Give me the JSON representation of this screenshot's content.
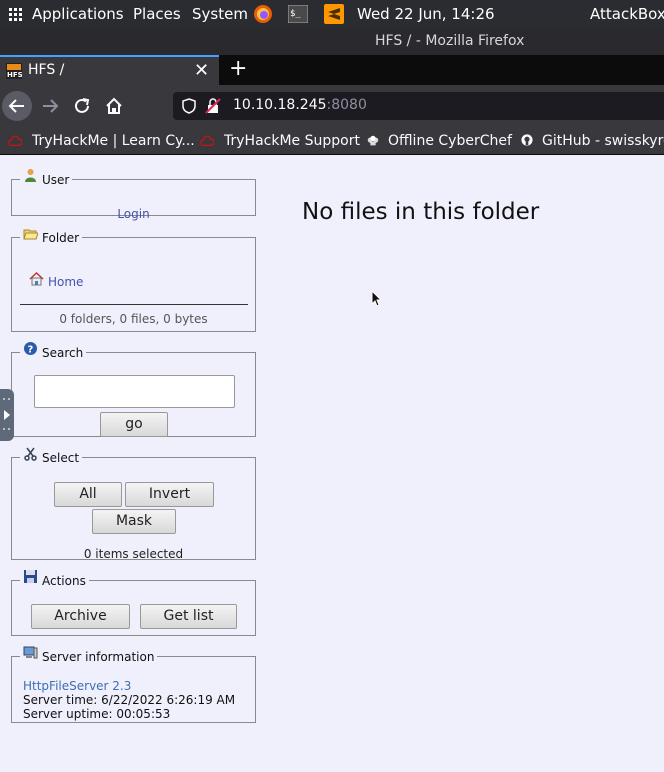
{
  "panel": {
    "applications": "Applications",
    "places": "Places",
    "system": "System",
    "datetime": "Wed 22 Jun, 14:26",
    "host": "AttackBox"
  },
  "window": {
    "title": "HFS / - Mozilla Firefox"
  },
  "tab": {
    "title": "HFS /",
    "close": "✕",
    "new_tab": "+"
  },
  "address": {
    "host": "10.10.18.245",
    "port": ":8080"
  },
  "bookmarks": [
    "TryHackMe | Learn Cy...",
    "TryHackMe Support",
    "Offline CyberChef",
    "GitHub - swisskyre"
  ],
  "page": {
    "user": {
      "legend": "User",
      "login": "Login"
    },
    "folder": {
      "legend": "Folder",
      "home": "Home",
      "stats": "0 folders, 0 files, 0 bytes"
    },
    "search": {
      "legend": "Search",
      "query": "",
      "go": "go"
    },
    "select": {
      "legend": "Select",
      "all": "All",
      "invert": "Invert",
      "mask": "Mask",
      "count": "0 items selected"
    },
    "actions": {
      "legend": "Actions",
      "archive": "Archive",
      "get_list": "Get list"
    },
    "server": {
      "legend": "Server information",
      "version": "HttpFileServer 2.3",
      "time": "Server time: 6/22/2022 6:26:19 AM",
      "uptime": "Server uptime: 00:05:53"
    },
    "empty_message": "No files in this folder"
  }
}
